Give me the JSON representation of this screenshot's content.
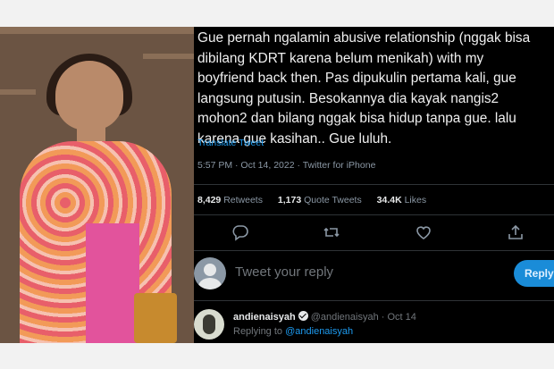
{
  "tweet": {
    "text": "Gue pernah ngalamin abusive relationship (nggak bisa\ndibilang KDRT karena belum menikah) with my\nboyfriend back then. Pas dipukulin pertama kali, gue\nlangsung putusin. Besokannya dia kayak nangis2\nmohon2 dan bilang nggak bisa hidup tanpa gue. lalu\nkarena gue kasihan.. Gue luluh.",
    "translate_label": "Translate Tweet",
    "meta": "5:57 PM · Oct 14, 2022 · Twitter for iPhone",
    "stats": [
      {
        "count": "8,429",
        "label": "Retweets"
      },
      {
        "count": "1,173",
        "label": "Quote Tweets"
      },
      {
        "count": "34.4K",
        "label": "Likes"
      }
    ],
    "actions": [
      "reply-icon",
      "retweet-icon",
      "like-icon",
      "share-icon"
    ]
  },
  "composer": {
    "placeholder": "Tweet your reply",
    "reply_button": "Reply"
  },
  "reply": {
    "name": "andienaisyah",
    "handle_date": "@andienaisyah · Oct 14",
    "replying_prefix": "Replying to",
    "replying_handle": "@andienaisyah"
  },
  "colors": {
    "background": "#000000",
    "link": "#1d9bf0",
    "muted": "#8b98a5",
    "reply_button": "#1a8cd8"
  }
}
